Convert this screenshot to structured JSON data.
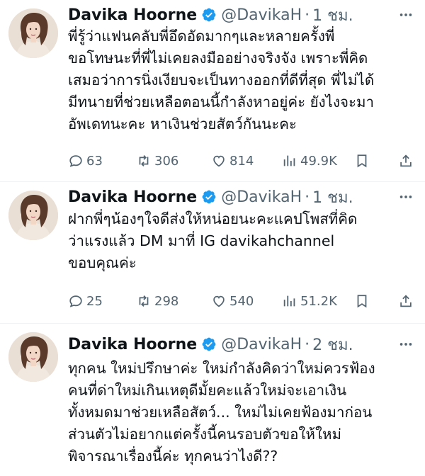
{
  "tweets": [
    {
      "name": "Davika Hoorne",
      "handle": "@DavikaH",
      "dot": "·",
      "time": "1 ชม.",
      "lines": [
        "พี่รู้ว่าแฟนคลับพี่อึดอัดมากๆและหลายครั้งพี่",
        "ขอโทษนะที่พี่ไม่เคยลงมืออย่างจริงจัง เพราะพี่คิด",
        "เสมอว่าการนิ่งเงียบจะเป็นทางออกที่ดีที่สุด พี่ไม่ได้",
        "มีทนายที่ช่วยเหลือตอนนี้กำลังหาอยู่ค่ะ ยังไงจะมา",
        "อัพเดทนะคะ หาเงินช่วยสัตว์กันนะคะ"
      ],
      "replies": "63",
      "retweets": "306",
      "likes": "814",
      "views": "49.9K"
    },
    {
      "name": "Davika Hoorne",
      "handle": "@DavikaH",
      "dot": "·",
      "time": "1 ชม.",
      "lines": [
        "ฝากพี่ๆน้องๆใจดีส่งให้หน่อยนะคะแคปโพสที่คิด",
        "ว่าแรงแล้ว DM มาที่ IG davikahchannel",
        "ขอบคุณค่ะ"
      ],
      "replies": "25",
      "retweets": "298",
      "likes": "540",
      "views": "51.2K"
    },
    {
      "name": "Davika Hoorne",
      "handle": "@DavikaH",
      "dot": "·",
      "time": "2 ชม.",
      "lines": [
        "ทุกคน ใหม่ปรึกษาค่ะ ใหม่กำลังคิดว่าใหม่ควรฟ้อง",
        "คนที่ด่าใหม่เกินเหตุดีมั้ยคะแล้วใหม่จะเอาเงิน",
        "ทั้งหมดมาช่วยเหลือสัตว์... ใหม่ไม่เคยฟ้องมาก่อน",
        "ส่วนตัวไม่อยากแต่ครั้งนี้คนรอบตัวขอให้ใหม่",
        "พิจารณาเรื่องนี้ค่ะ ทุกคนว่าไงดี??"
      ]
    }
  ],
  "icons": {
    "verified": "verified-badge-icon",
    "more": "more-options-icon",
    "reply": "reply-icon",
    "retweet": "retweet-icon",
    "like": "heart-icon",
    "views": "views-chart-icon",
    "bookmark": "bookmark-icon",
    "share": "share-icon"
  },
  "colors": {
    "verified": "#1d9bf0",
    "text": "#0f1419",
    "secondary": "#536471",
    "divider": "#eff3f4"
  }
}
